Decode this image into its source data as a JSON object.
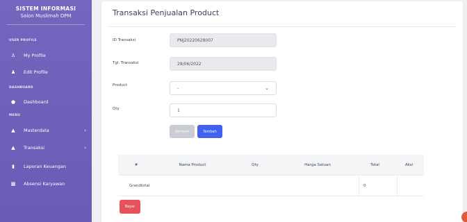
{
  "sidebar": {
    "brand_title": "SISTEM INFORMASI",
    "brand_sub": "Salon Muslimah DPM",
    "sections": {
      "user_profile": "USER PROFILE",
      "dashboard": "DASHBOARD",
      "menu": "MENU"
    },
    "items": [
      {
        "label": "My Profile",
        "icon": "person-icon"
      },
      {
        "label": "Edit Profile",
        "icon": "user-edit-icon"
      },
      {
        "label": "Dashboard",
        "icon": "dashboard-icon"
      },
      {
        "label": "Masterdata",
        "icon": "triangle-icon"
      },
      {
        "label": "Transaksi",
        "icon": "triangle-icon"
      },
      {
        "label": "Laporan Keuangan",
        "icon": "document-icon"
      },
      {
        "label": "Absensi Karyawan",
        "icon": "calendar-icon"
      }
    ]
  },
  "main": {
    "title": "Transaksi Penjualan Product",
    "form": {
      "id_label": "ID Transaksi",
      "id_value": "PNJ20220628007",
      "tgl_label": "Tgl. Transaksi",
      "tgl_value": "28/06/2022",
      "product_label": "Product",
      "product_value": "-",
      "qty_label": "Qty",
      "qty_value": "1"
    },
    "buttons": {
      "kembali": "Kembali",
      "tambah": "Tambah",
      "bayar": "Bayar"
    },
    "table": {
      "headers": [
        "#",
        "Nama Product",
        "Qty",
        "Harga Satuan",
        "Total",
        "Aksi"
      ],
      "grandtotal_label": "Grandtotal",
      "grandtotal_value": "0"
    }
  },
  "colors": {
    "sidebar": "#6a5cb6",
    "primary": "#4361ee",
    "danger": "#e7515a"
  }
}
